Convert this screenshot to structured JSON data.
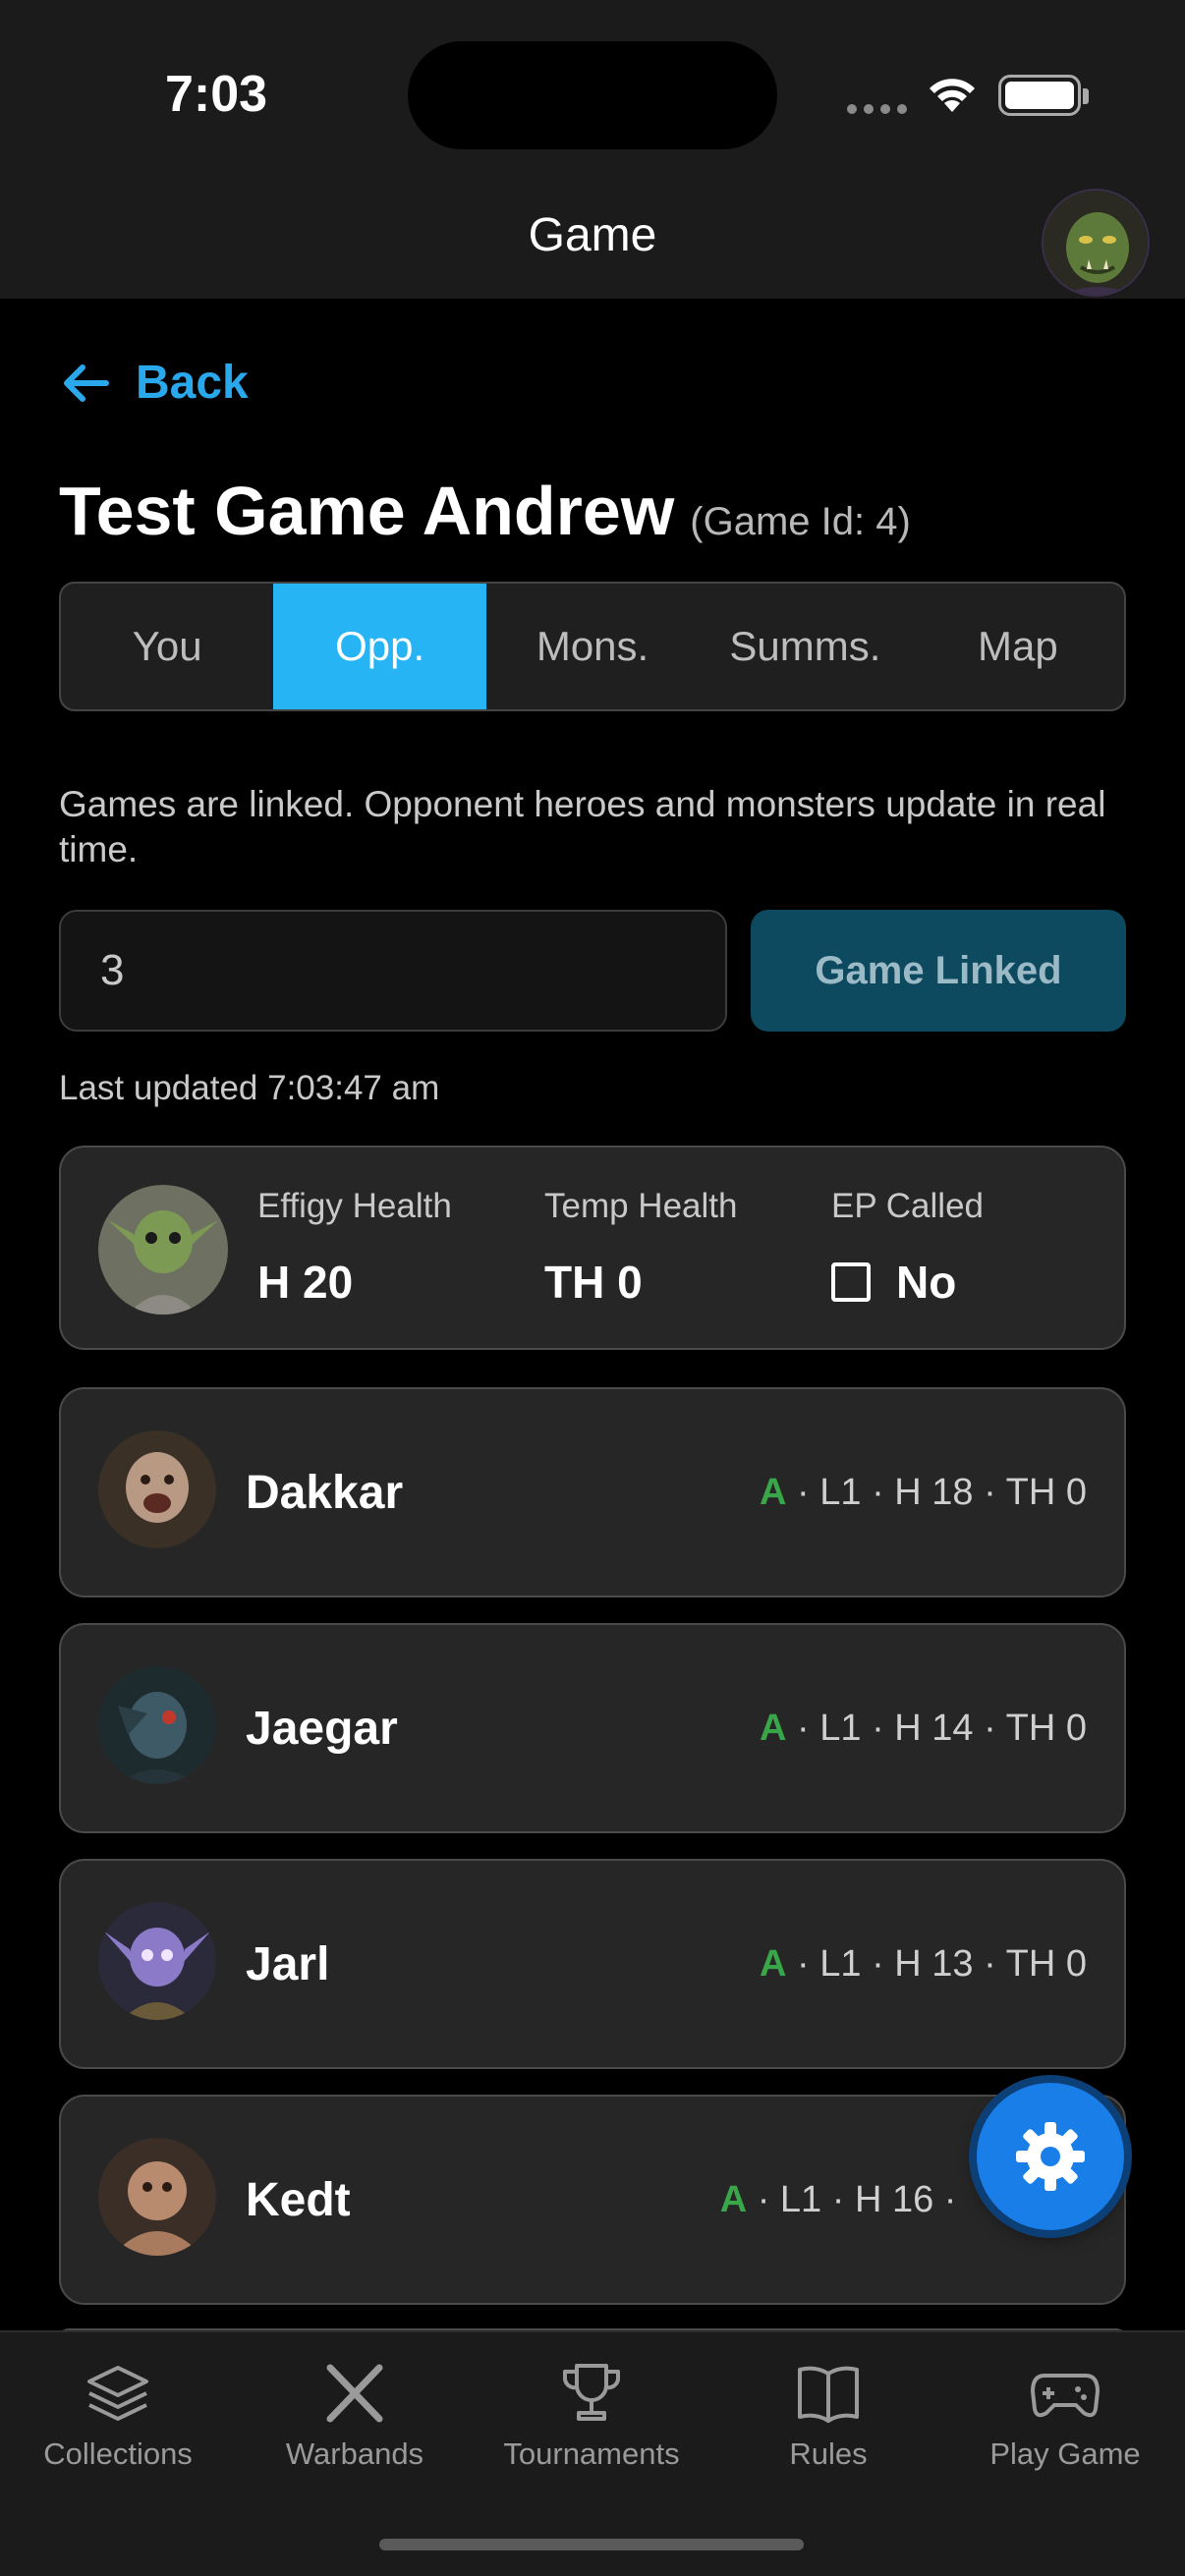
{
  "status_bar": {
    "time": "7:03"
  },
  "nav": {
    "title": "Game",
    "avatar_icon": "orc-avatar-icon"
  },
  "back": {
    "label": "Back"
  },
  "game": {
    "title": "Test Game Andrew",
    "id_label": "(Game Id: 4)"
  },
  "tabs": [
    {
      "label": "You",
      "active": false
    },
    {
      "label": "Opp.",
      "active": true
    },
    {
      "label": "Mons.",
      "active": false
    },
    {
      "label": "Summs.",
      "active": false
    },
    {
      "label": "Map",
      "active": false
    }
  ],
  "link": {
    "info": "Games are linked. Opponent heroes and monsters update in real time.",
    "input_value": "3",
    "button_label": "Game Linked",
    "last_updated": "Last updated 7:03:47 am"
  },
  "effigy": {
    "health_label": "Effigy Health",
    "health_value": "H 20",
    "temp_label": "Temp Health",
    "temp_value": "TH 0",
    "ep_label": "EP Called",
    "ep_value": "No"
  },
  "heroes": [
    {
      "name": "Dakkar",
      "status": "A",
      "stats": " · L1 · H 18 · TH 0"
    },
    {
      "name": "Jaegar",
      "status": "A",
      "stats": " · L1 · H 14 · TH 0"
    },
    {
      "name": "Jarl",
      "status": "A",
      "stats": " · L1 · H 13 · TH 0"
    },
    {
      "name": "Kedt",
      "status": "A",
      "stats": " · L1 · H 16 · "
    }
  ],
  "tabbar": [
    {
      "label": "Collections",
      "icon": "layers-icon"
    },
    {
      "label": "Warbands",
      "icon": "crossed-swords-icon"
    },
    {
      "label": "Tournaments",
      "icon": "trophy-icon"
    },
    {
      "label": "Rules",
      "icon": "book-icon"
    },
    {
      "label": "Play Game",
      "icon": "gamepad-icon"
    }
  ],
  "colors": {
    "accent": "#27b4f5",
    "link_button": "#0d4a60",
    "active_status": "#3aa64a",
    "fab": "#1a7ee8"
  }
}
